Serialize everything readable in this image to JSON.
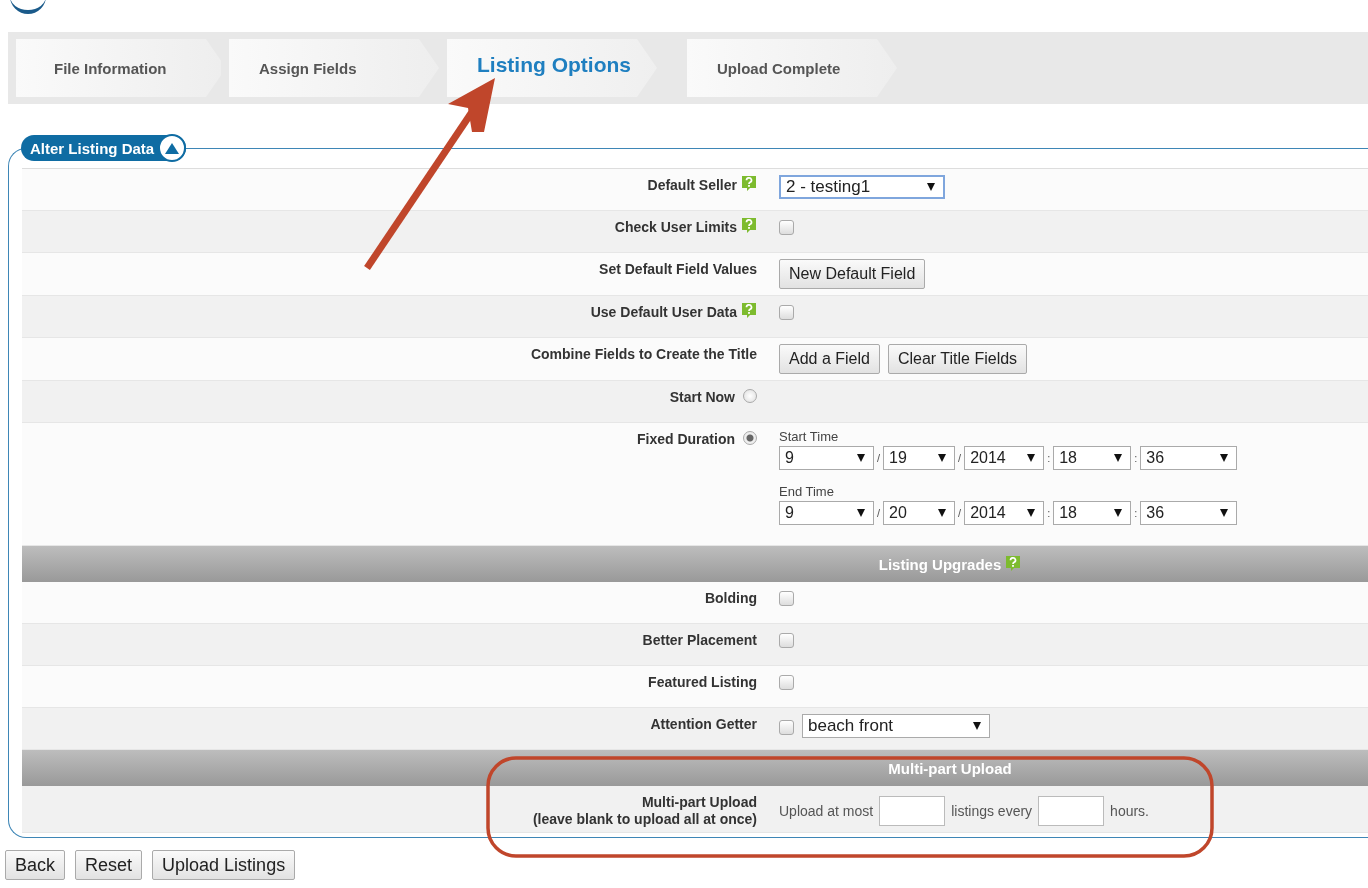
{
  "steps": [
    {
      "label": "File Information",
      "selected": false
    },
    {
      "label": "Assign Fields",
      "selected": false
    },
    {
      "label": "Listing Options",
      "selected": true
    },
    {
      "label": "Upload Complete",
      "selected": false
    }
  ],
  "panel": {
    "title": "Alter Listing Data",
    "expanded": true,
    "sections": [
      {
        "rows": [
          {
            "kind": "select",
            "label": "Default Seller",
            "help": true,
            "value": "2 - testing1"
          },
          {
            "kind": "checkbox",
            "label": "Check User Limits",
            "help": true,
            "checked": false
          },
          {
            "kind": "buttons",
            "label": "Set Default Field Values",
            "help": false,
            "buttons": [
              "New Default Field"
            ]
          },
          {
            "kind": "checkbox",
            "label": "Use Default User Data",
            "help": true,
            "checked": false
          },
          {
            "kind": "buttons",
            "label": "Combine Fields to Create the Title",
            "help": false,
            "buttons": [
              "Add a Field",
              "Clear Title Fields"
            ]
          },
          {
            "kind": "radio",
            "label": "Start Now",
            "help": false,
            "selected": false
          },
          {
            "kind": "radio",
            "label": "Fixed Duration",
            "help": false,
            "selected": true,
            "times": [
              {
                "label": "Start Time",
                "fields": [
                  "9",
                  "19",
                  "2014",
                  "18",
                  "36"
                ],
                "separators": [
                  "/",
                  "/",
                  ":",
                  ":"
                ]
              },
              {
                "label": "End Time",
                "fields": [
                  "9",
                  "20",
                  "2014",
                  "18",
                  "36"
                ],
                "separators": [
                  "/",
                  "/",
                  ":",
                  ":"
                ]
              }
            ]
          }
        ]
      },
      {
        "header": "Listing Upgrades",
        "help": true,
        "rows": [
          {
            "kind": "checkbox",
            "label": "Bolding",
            "help": false,
            "checked": false
          },
          {
            "kind": "checkbox",
            "label": "Better Placement",
            "help": false,
            "checked": false
          },
          {
            "kind": "checkbox",
            "label": "Featured Listing",
            "help": false,
            "checked": false
          },
          {
            "kind": "checkbox_select",
            "label": "Attention Getter",
            "help": false,
            "checked": false,
            "value": "beach front"
          }
        ]
      },
      {
        "header": "Multi-part Upload",
        "help": false,
        "rows": [
          {
            "kind": "multipart",
            "label": "Multi-part Upload",
            "note": "(leave blank to upload all at once)",
            "help": false,
            "texts": [
              "Upload at most",
              "listings every",
              "hours."
            ]
          }
        ]
      }
    ]
  },
  "buttons": [
    "Back",
    "Reset",
    "Upload Listings"
  ]
}
